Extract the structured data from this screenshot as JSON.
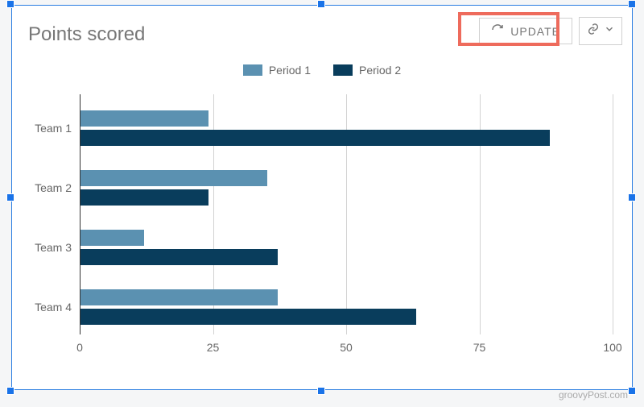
{
  "chart_data": {
    "type": "bar",
    "orientation": "horizontal",
    "title": "Points scored",
    "categories": [
      "Team 1",
      "Team 2",
      "Team 3",
      "Team 4"
    ],
    "series": [
      {
        "name": "Period 1",
        "color": "#5b91b1",
        "values": [
          24,
          35,
          12,
          37
        ]
      },
      {
        "name": "Period 2",
        "color": "#093d5c",
        "values": [
          88,
          24,
          37,
          63
        ]
      }
    ],
    "xlabel": "",
    "ylabel": "",
    "xlim": [
      0,
      100
    ],
    "xticks": [
      0,
      25,
      50,
      75,
      100
    ]
  },
  "toolbar": {
    "update_label": "UPDATE"
  },
  "watermark": "groovyPost.com"
}
